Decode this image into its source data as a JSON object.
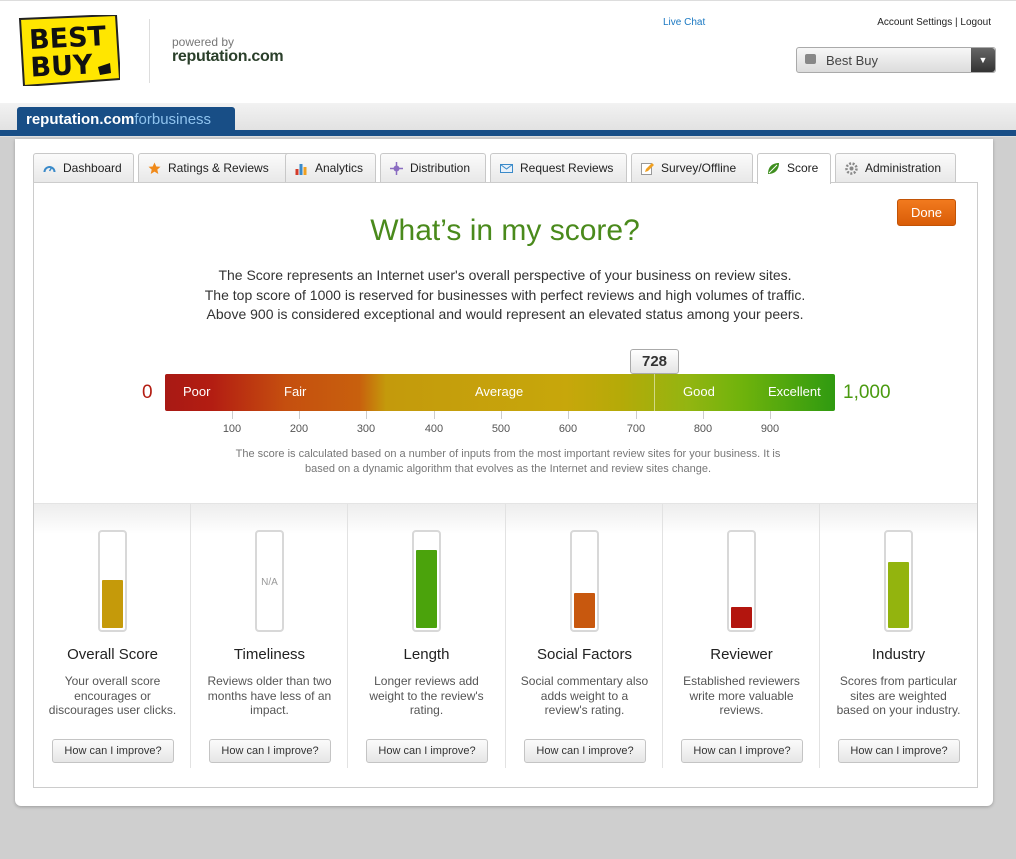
{
  "header": {
    "logo_text": "BEST BUY",
    "powered_by": "powered by",
    "powered_brand": "reputation.com",
    "live_chat": "Live Chat",
    "account_settings": "Account Settings",
    "separator": "|",
    "logout": "Logout",
    "business_select": "Best Buy"
  },
  "brandbar": {
    "brand_main": "reputation.com",
    "brand_sub": "forbusiness"
  },
  "tabs": [
    {
      "label": "Dashboard",
      "icon": "gauge-icon",
      "active": false
    },
    {
      "label": "Ratings & Reviews",
      "icon": "star-icon",
      "active": false
    },
    {
      "label": "Analytics",
      "icon": "bar-chart-icon",
      "active": false
    },
    {
      "label": "Distribution",
      "icon": "network-icon",
      "active": false
    },
    {
      "label": "Request Reviews",
      "icon": "envelope-icon",
      "active": false
    },
    {
      "label": "Survey/Offline",
      "icon": "pencil-icon",
      "active": false
    },
    {
      "label": "Score",
      "icon": "leaf-icon",
      "active": true
    },
    {
      "label": "Administration",
      "icon": "gear-icon",
      "active": false
    }
  ],
  "score_page": {
    "done_label": "Done",
    "headline": "What’s in my score?",
    "description": [
      "The Score represents an Internet user's overall perspective of your business on review sites.",
      "The top score of 1000 is reserved for businesses with perfect reviews and high volumes of traffic.",
      "Above 900 is considered exceptional and would represent an elevated status among your peers."
    ],
    "scale_min": "0",
    "scale_max": "1,000",
    "segments": [
      "Poor",
      "Fair",
      "Average",
      "Good",
      "Excellent"
    ],
    "score": 728,
    "score_label": "728",
    "ticks": [
      "100",
      "200",
      "300",
      "400",
      "500",
      "600",
      "700",
      "800",
      "900"
    ],
    "note": "The score is calculated based on a number of inputs from the most important review sites for your business. It is based on a dynamic algorithm that evolves as the Internet and review sites change."
  },
  "factors": [
    {
      "title": "Overall Score",
      "desc": "Your overall score encourages or discourages user clicks.",
      "level": 0.51,
      "color": "#c59a0a",
      "na": "",
      "button": "How can I improve?"
    },
    {
      "title": "Timeliness",
      "desc": "Reviews older than two months have less of an impact.",
      "level": 0,
      "color": "#ffffff",
      "na": "N/A",
      "button": "How can I improve?"
    },
    {
      "title": "Length",
      "desc": "Longer reviews add weight to the review's rating.",
      "level": 0.83,
      "color": "#4ba30c",
      "na": "",
      "button": "How can I improve?"
    },
    {
      "title": "Social Factors",
      "desc": "Social commentary also adds weight to a review's rating.",
      "level": 0.37,
      "color": "#c8580e",
      "na": "",
      "button": "How can I improve?"
    },
    {
      "title": "Reviewer",
      "desc": "Established reviewers write more valuable reviews.",
      "level": 0.22,
      "color": "#b3150e",
      "na": "",
      "button": "How can I improve?"
    },
    {
      "title": "Industry",
      "desc": "Scores from particular sites are weighted based on your industry.",
      "level": 0.7,
      "color": "#93b40e",
      "na": "",
      "button": "How can I improve?"
    }
  ]
}
